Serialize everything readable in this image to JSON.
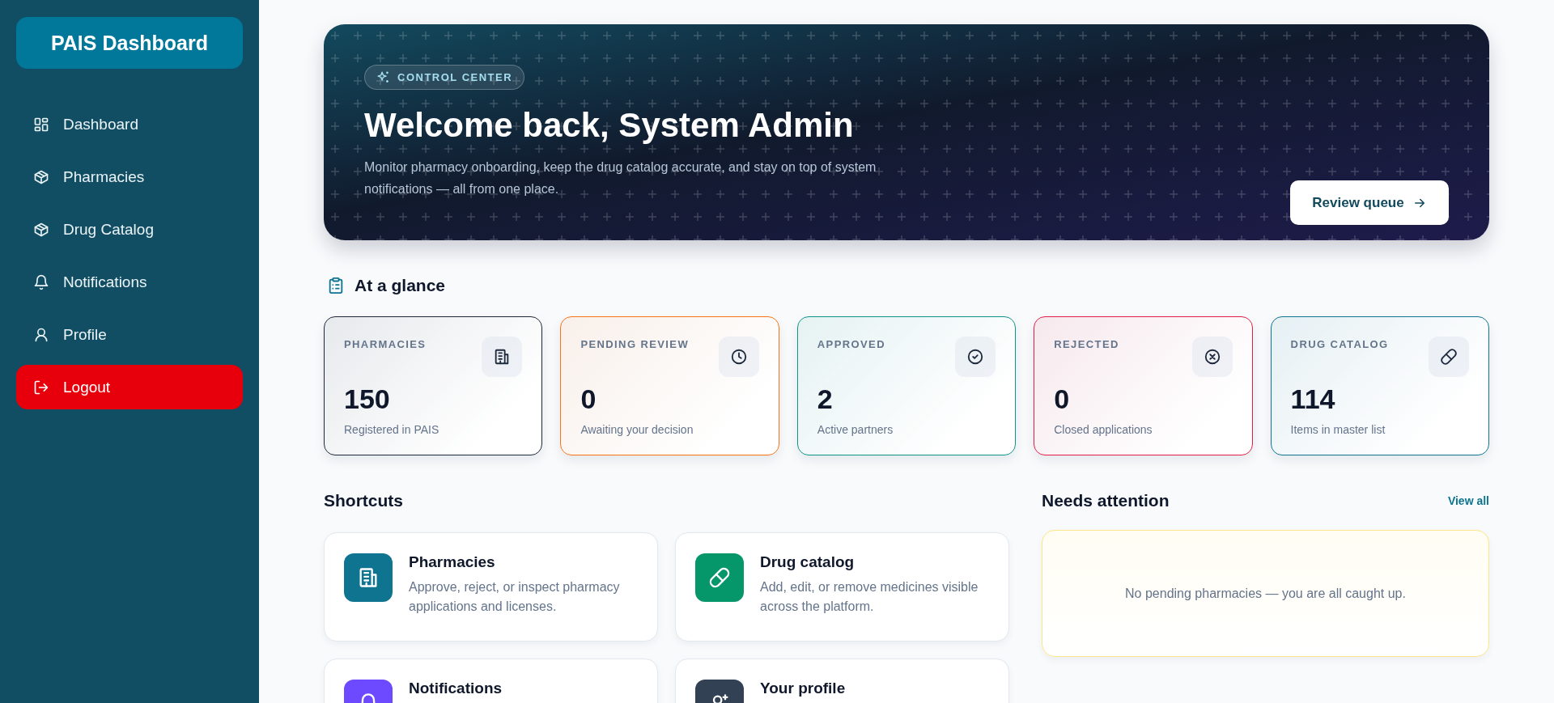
{
  "sidebar": {
    "brand": "PAIS Dashboard",
    "items": [
      {
        "label": "Dashboard",
        "kind": "nav"
      },
      {
        "label": "Pharmacies",
        "kind": "nav"
      },
      {
        "label": "Drug Catalog",
        "kind": "nav"
      },
      {
        "label": "Notifications",
        "kind": "nav"
      },
      {
        "label": "Profile",
        "kind": "nav"
      },
      {
        "label": "Logout",
        "kind": "danger"
      }
    ]
  },
  "hero": {
    "badge": "CONTROL CENTER",
    "title": "Welcome back, System Admin",
    "description": "Monitor pharmacy onboarding, keep the drug catalog accurate, and stay on top of system notifications — all from one place.",
    "button": "Review queue"
  },
  "glance": {
    "title": "At a glance",
    "cards": [
      {
        "label": "PHARMACIES",
        "value": "150",
        "note": "Registered in PAIS",
        "color": "#1e293b"
      },
      {
        "label": "PENDING REVIEW",
        "value": "0",
        "note": "Awaiting your decision",
        "color": "#f97316"
      },
      {
        "label": "APPROVED",
        "value": "2",
        "note": "Active partners",
        "color": "#0d9488"
      },
      {
        "label": "REJECTED",
        "value": "0",
        "note": "Closed applications",
        "color": "#e11d48"
      },
      {
        "label": "DRUG CATALOG",
        "value": "114",
        "note": "Items in master list",
        "color": "#0e7490"
      }
    ]
  },
  "shortcuts": {
    "title": "Shortcuts",
    "items": [
      {
        "title": "Pharmacies",
        "description": "Approve, reject, or inspect pharmacy applications and licenses.",
        "color": "#0e7490"
      },
      {
        "title": "Drug catalog",
        "description": "Add, edit, or remove medicines visible across the platform.",
        "color": "#059669"
      },
      {
        "title": "Notifications",
        "color": "#6d4aff"
      },
      {
        "title": "Your profile",
        "color": "#334155"
      }
    ]
  },
  "attention": {
    "title": "Needs attention",
    "link": "View all",
    "empty_message": "No pending pharmacies — you are all caught up."
  }
}
